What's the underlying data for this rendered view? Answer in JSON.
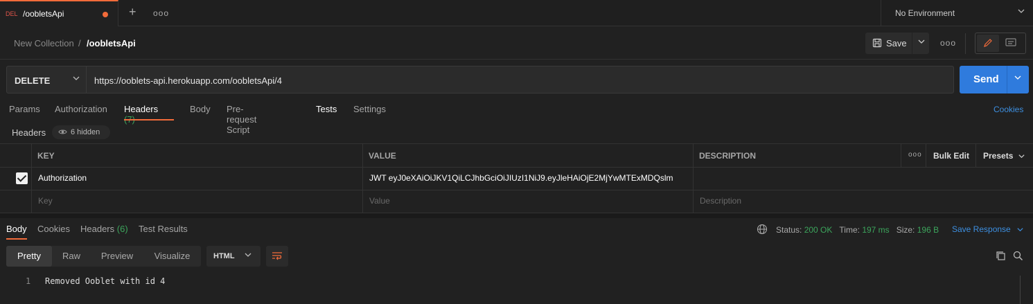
{
  "tab": {
    "method_badge": "DEL",
    "name": "/oobletsApi"
  },
  "environment": {
    "label": "No Environment"
  },
  "breadcrumb": {
    "collection": "New Collection",
    "separator": "/",
    "request": "/oobletsApi"
  },
  "toolbar": {
    "save_label": "Save"
  },
  "request": {
    "method": "DELETE",
    "url": "https://ooblets-api.herokuapp.com/oobletsApi/4",
    "send_label": "Send"
  },
  "request_tabs": [
    {
      "label": "Params"
    },
    {
      "label": "Authorization"
    },
    {
      "label": "Headers",
      "count": "(7)"
    },
    {
      "label": "Body"
    },
    {
      "label": "Pre-request Script"
    },
    {
      "label": "Tests"
    },
    {
      "label": "Settings"
    }
  ],
  "cookies_label": "Cookies",
  "headers_section": {
    "title": "Headers",
    "hidden": "6 hidden"
  },
  "headers_table": {
    "columns": {
      "key": "KEY",
      "value": "VALUE",
      "description": "DESCRIPTION",
      "bulk_edit": "Bulk Edit",
      "presets": "Presets"
    },
    "rows": [
      {
        "key": "Authorization",
        "value": "JWT eyJ0eXAiOiJKV1QiLCJhbGciOiJIUzI1NiJ9.eyJleHAiOjE2MjYwMTExMDQslm",
        "description": ""
      }
    ],
    "placeholder": {
      "key": "Key",
      "value": "Value",
      "description": "Description"
    }
  },
  "response_tabs": [
    {
      "label": "Body"
    },
    {
      "label": "Cookies"
    },
    {
      "label": "Headers",
      "count": "(6)"
    },
    {
      "label": "Test Results"
    }
  ],
  "response_status": {
    "status_label": "Status:",
    "status_value": "200 OK",
    "time_label": "Time:",
    "time_value": "197 ms",
    "size_label": "Size:",
    "size_value": "196 B",
    "save_response": "Save Response"
  },
  "view_modes": [
    "Pretty",
    "Raw",
    "Preview",
    "Visualize"
  ],
  "format": "HTML",
  "response_body": {
    "line_number": "1",
    "text": "Removed Ooblet with id 4"
  },
  "colors": {
    "accent": "#f26b3a",
    "send": "#2f7bdd",
    "success": "#3ca55c",
    "link": "#3d8fe0"
  }
}
